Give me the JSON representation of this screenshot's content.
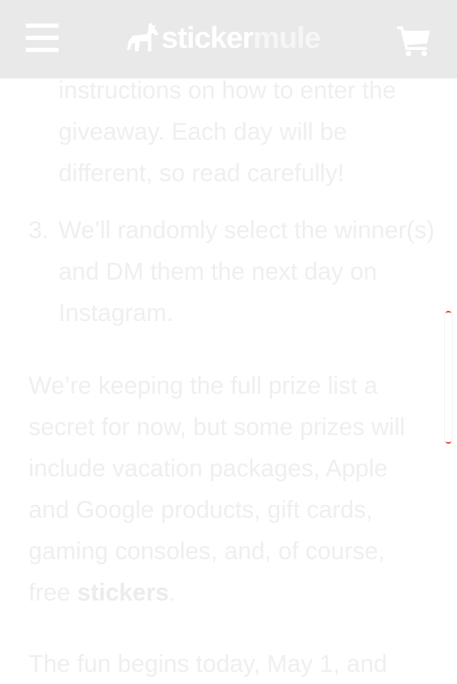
{
  "header": {
    "logo_part1": "sticker",
    "logo_part2": "mule",
    "menu_icon": "hamburger-menu-icon",
    "cart_icon": "shopping-cart-icon"
  },
  "content": {
    "list_continuation": "instructions on how to enter the giveaway. Each day will be different, so read carefully!",
    "list_item_3_number": "3.",
    "list_item_3_text": "We’ll randomly select the winner(s) and DM them the next day on Instagram.",
    "paragraph_1_text": "We’re keeping the full prize list a secret for now, but some prizes will include vacation packages, Apple and Google products, gift cards, gaming consoles, and, of course, free",
    "paragraph_1_link": "stickers",
    "paragraph_1_end": ".",
    "paragraph_2_text": "The fun begins today, May 1, and"
  },
  "colors": {
    "header_bg": "#e9e9e9",
    "text_faded": "#efefef",
    "scrollbar_accent": "#e33b1a"
  }
}
